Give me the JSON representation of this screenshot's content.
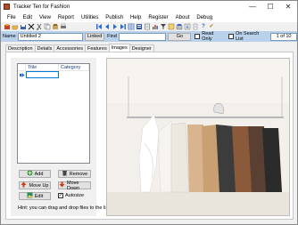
{
  "window": {
    "title": "Tracker Ten for Fashion",
    "minimize": "—",
    "maximize": "☐",
    "close": "✕"
  },
  "menu": [
    "File",
    "Edit",
    "View",
    "Report",
    "Utilities",
    "Publish",
    "Help",
    "Register",
    "About",
    "Debug"
  ],
  "toolbar": {
    "icons_left": [
      "new-record-icon",
      "open-icon",
      "save-icon",
      "delete-icon",
      "cut-icon",
      "copy-icon",
      "paste-icon",
      "print-icon"
    ],
    "icons_right": [
      "first-record-icon",
      "previous-record-icon",
      "next-record-icon",
      "last-record-icon",
      "table-view-icon",
      "form-view-icon",
      "report-icon",
      "chart-icon",
      "filter-icon",
      "sort-icon",
      "export-icon",
      "import-icon",
      "spell-check-icon",
      "help-icon",
      "check-icon"
    ],
    "help_glyph": "?",
    "check_glyph": "✔"
  },
  "record_bar": {
    "name_label": "Name",
    "name_value": "Untitled 2",
    "linked_label": "Linked",
    "find_label": "Find",
    "find_value": "",
    "go_label": "Go",
    "read_only_label": "Read Only",
    "on_search_list_label": "On Search List",
    "record_count": "1 of 10"
  },
  "tabs": [
    "Description",
    "Details",
    "Accessories",
    "Features",
    "Images",
    "Designer"
  ],
  "active_tab": "Images",
  "images": {
    "columns": [
      "Title",
      "Category"
    ],
    "rows": [
      {
        "title": "",
        "category": ""
      }
    ],
    "add_label": "Add",
    "remove_label": "Remove",
    "move_up_label": "Move Up",
    "move_down_label": "Move Down",
    "edit_label": "Edit",
    "autosize_label": "Autosize",
    "autosize_checked": true,
    "hint": "Hint: you can drag and drop files to the list."
  },
  "colors": {
    "record_bar_bg": "#b9d1ea",
    "selection_border": "#0078d7",
    "add_icon": "#2e9b2e",
    "remove_icon": "#444444",
    "arrow_icon": "#cc3a1a"
  }
}
